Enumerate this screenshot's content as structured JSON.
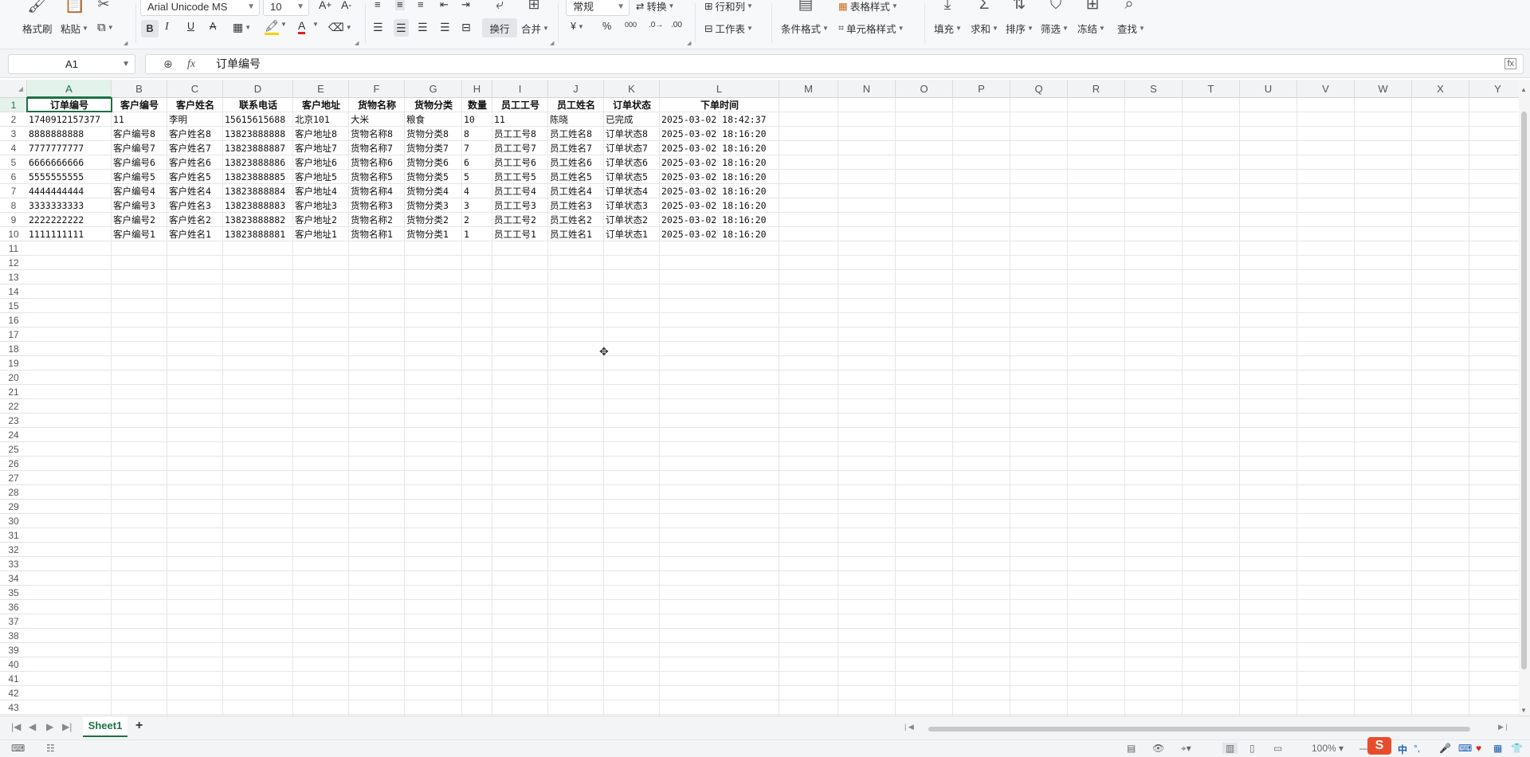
{
  "ribbon": {
    "font_name": "Arial Unicode MS",
    "font_size": "10",
    "format_brush": "格式刷",
    "paste": "粘贴",
    "wrap": "换行",
    "merge": "合并",
    "number_format": "常规",
    "convert": "转换",
    "rows_cols": "行和列",
    "worksheet": "工作表",
    "cond_format": "条件格式",
    "table_style": "表格样式",
    "cell_style": "单元格样式",
    "fill": "填充",
    "sum": "求和",
    "sort": "排序",
    "filter": "筛选",
    "freeze": "冻结",
    "find": "查找",
    "currency_symbol": "¥",
    "percent_symbol": "%",
    "thousands_symbol": "000"
  },
  "formula_bar": {
    "name_box": "A1",
    "fx": "fx",
    "content": "订单编号"
  },
  "columns": [
    "A",
    "B",
    "C",
    "D",
    "E",
    "F",
    "G",
    "H",
    "I",
    "J",
    "K",
    "L",
    "M",
    "N",
    "O",
    "P",
    "Q",
    "R",
    "S",
    "T",
    "U",
    "V",
    "W",
    "X",
    "Y"
  ],
  "row_numbers": [
    "1",
    "2",
    "3",
    "4",
    "5",
    "6",
    "7",
    "8",
    "9",
    "10",
    "11",
    "12",
    "13",
    "14",
    "15",
    "16",
    "17",
    "18",
    "19",
    "20",
    "21",
    "22",
    "23",
    "24",
    "25",
    "26",
    "27",
    "28",
    "29",
    "30",
    "31",
    "32",
    "33",
    "34",
    "35",
    "36",
    "37",
    "38",
    "39",
    "40",
    "41",
    "42",
    "43"
  ],
  "table": {
    "headers": [
      "订单编号",
      "客户编号",
      "客户姓名",
      "联系电话",
      "客户地址",
      "货物名称",
      "货物分类",
      "数量",
      "员工工号",
      "员工姓名",
      "订单状态",
      "下单时间"
    ],
    "rows": [
      [
        "1740912157377",
        "11",
        "李明",
        "15615615688",
        "北京101",
        "大米",
        "粮食",
        "10",
        "11",
        "陈晓",
        "已完成",
        "2025-03-02 18:42:37"
      ],
      [
        "8888888888",
        "客户编号8",
        "客户姓名8",
        "13823888888",
        "客户地址8",
        "货物名称8",
        "货物分类8",
        "8",
        "员工工号8",
        "员工姓名8",
        "订单状态8",
        "2025-03-02 18:16:20"
      ],
      [
        "7777777777",
        "客户编号7",
        "客户姓名7",
        "13823888887",
        "客户地址7",
        "货物名称7",
        "货物分类7",
        "7",
        "员工工号7",
        "员工姓名7",
        "订单状态7",
        "2025-03-02 18:16:20"
      ],
      [
        "6666666666",
        "客户编号6",
        "客户姓名6",
        "13823888886",
        "客户地址6",
        "货物名称6",
        "货物分类6",
        "6",
        "员工工号6",
        "员工姓名6",
        "订单状态6",
        "2025-03-02 18:16:20"
      ],
      [
        "5555555555",
        "客户编号5",
        "客户姓名5",
        "13823888885",
        "客户地址5",
        "货物名称5",
        "货物分类5",
        "5",
        "员工工号5",
        "员工姓名5",
        "订单状态5",
        "2025-03-02 18:16:20"
      ],
      [
        "4444444444",
        "客户编号4",
        "客户姓名4",
        "13823888884",
        "客户地址4",
        "货物名称4",
        "货物分类4",
        "4",
        "员工工号4",
        "员工姓名4",
        "订单状态4",
        "2025-03-02 18:16:20"
      ],
      [
        "3333333333",
        "客户编号3",
        "客户姓名3",
        "13823888883",
        "客户地址3",
        "货物名称3",
        "货物分类3",
        "3",
        "员工工号3",
        "员工姓名3",
        "订单状态3",
        "2025-03-02 18:16:20"
      ],
      [
        "2222222222",
        "客户编号2",
        "客户姓名2",
        "13823888882",
        "客户地址2",
        "货物名称2",
        "货物分类2",
        "2",
        "员工工号2",
        "员工姓名2",
        "订单状态2",
        "2025-03-02 18:16:20"
      ],
      [
        "1111111111",
        "客户编号1",
        "客户姓名1",
        "13823888881",
        "客户地址1",
        "货物名称1",
        "货物分类1",
        "1",
        "员工工号1",
        "员工姓名1",
        "订单状态1",
        "2025-03-02 18:16:20"
      ]
    ]
  },
  "sheet_tabs": {
    "active": "Sheet1",
    "add": "+"
  },
  "status": {
    "zoom": "100%"
  },
  "ime": {
    "lang": "中"
  },
  "colors": {
    "accent": "#1e7145",
    "selection_bg": "#e3f2ea"
  }
}
